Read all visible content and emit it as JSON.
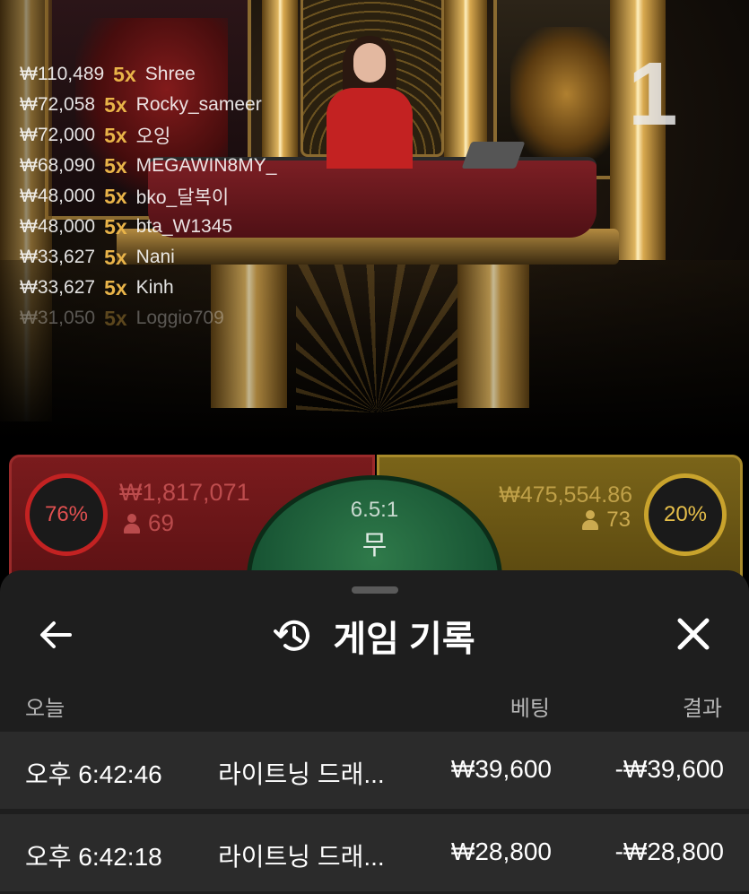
{
  "stream": {
    "round_number": "1",
    "winners": [
      {
        "amount": "₩110,489",
        "multiplier": "5x",
        "name": "Shree"
      },
      {
        "amount": "₩72,058",
        "multiplier": "5x",
        "name": "Rocky_sameer"
      },
      {
        "amount": "₩72,000",
        "multiplier": "5x",
        "name": "오잉"
      },
      {
        "amount": "₩68,090",
        "multiplier": "5x",
        "name": "MEGAWIN8MY_"
      },
      {
        "amount": "₩48,000",
        "multiplier": "5x",
        "name": "bko_달복이"
      },
      {
        "amount": "₩48,000",
        "multiplier": "5x",
        "name": "bta_W1345"
      },
      {
        "amount": "₩33,627",
        "multiplier": "5x",
        "name": "Nani"
      },
      {
        "amount": "₩33,627",
        "multiplier": "5x",
        "name": "Kinh"
      },
      {
        "amount": "₩31,050",
        "multiplier": "5x",
        "name": "Loggio709"
      }
    ]
  },
  "board": {
    "dragon": {
      "percent": "76%",
      "total": "₩1,817,071",
      "players": "69",
      "color": "#c32222"
    },
    "tie": {
      "payout": "6.5:1",
      "label": "무",
      "color": "#2f7a4a"
    },
    "tiger": {
      "percent": "20%",
      "total": "₩475,554.86",
      "players": "73",
      "color": "#c9a32c"
    }
  },
  "history": {
    "title": "게임 기록",
    "back_icon": "arrow-left-icon",
    "history_icon": "history-clock-icon",
    "close_icon": "close-icon",
    "columns": {
      "date": "오늘",
      "bet": "베팅",
      "result": "결과"
    },
    "rows": [
      {
        "time": "오후 6:42:46",
        "game": "라이트닝 드래...",
        "bet": "₩39,600",
        "result": "-₩39,600"
      },
      {
        "time": "오후 6:42:18",
        "game": "라이트닝 드래...",
        "bet": "₩28,800",
        "result": "-₩28,800"
      }
    ]
  }
}
